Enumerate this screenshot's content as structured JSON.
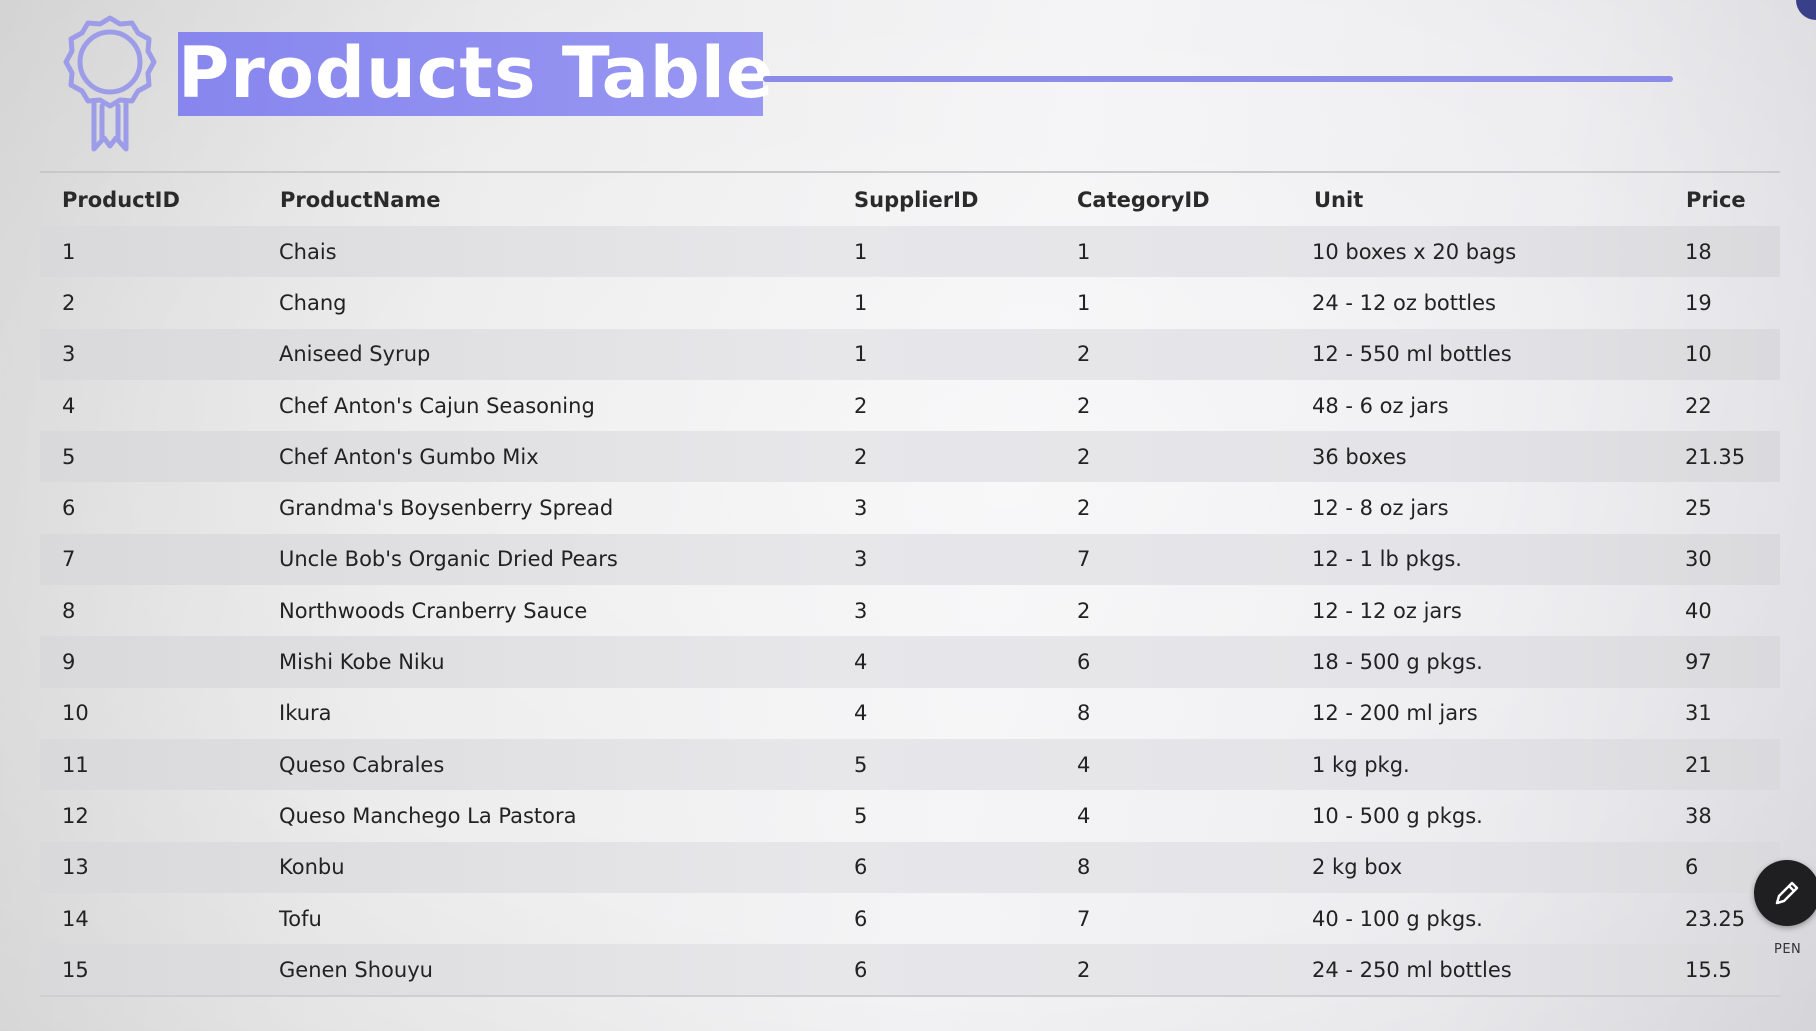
{
  "title": "Products Table",
  "colors": {
    "title_bg": "#8c8bf0",
    "title_line": "#8c8ce8",
    "badge_stroke": "#9d9ce8",
    "pen_button": "#1f1f21"
  },
  "icons": {
    "badge": "award-ribbon-icon",
    "pen": "pencil-icon"
  },
  "pen_label": "PEN",
  "table": {
    "columns": [
      "ProductID",
      "ProductName",
      "SupplierID",
      "CategoryID",
      "Unit",
      "Price"
    ],
    "rows": [
      [
        "1",
        "Chais",
        "1",
        "1",
        "10 boxes x 20 bags",
        "18"
      ],
      [
        "2",
        "Chang",
        "1",
        "1",
        "24 - 12 oz bottles",
        "19"
      ],
      [
        "3",
        "Aniseed Syrup",
        "1",
        "2",
        "12 - 550 ml bottles",
        "10"
      ],
      [
        "4",
        "Chef Anton's Cajun Seasoning",
        "2",
        "2",
        "48 - 6 oz jars",
        "22"
      ],
      [
        "5",
        "Chef Anton's Gumbo Mix",
        "2",
        "2",
        "36 boxes",
        "21.35"
      ],
      [
        "6",
        "Grandma's Boysenberry Spread",
        "3",
        "2",
        "12 - 8 oz jars",
        "25"
      ],
      [
        "7",
        "Uncle Bob's Organic Dried Pears",
        "3",
        "7",
        "12 - 1 lb pkgs.",
        "30"
      ],
      [
        "8",
        "Northwoods Cranberry Sauce",
        "3",
        "2",
        "12 - 12 oz jars",
        "40"
      ],
      [
        "9",
        "Mishi Kobe Niku",
        "4",
        "6",
        "18 - 500 g pkgs.",
        "97"
      ],
      [
        "10",
        "Ikura",
        "4",
        "8",
        "12 - 200 ml jars",
        "31"
      ],
      [
        "11",
        "Queso Cabrales",
        "5",
        "4",
        "1 kg pkg.",
        "21"
      ],
      [
        "12",
        "Queso Manchego La Pastora",
        "5",
        "4",
        "10 - 500 g pkgs.",
        "38"
      ],
      [
        "13",
        "Konbu",
        "6",
        "8",
        "2 kg box",
        "6"
      ],
      [
        "14",
        "Tofu",
        "6",
        "7",
        "40 - 100 g pkgs.",
        "23.25"
      ],
      [
        "15",
        "Genen Shouyu",
        "6",
        "2",
        "24 - 250 ml bottles",
        "15.5"
      ]
    ]
  }
}
